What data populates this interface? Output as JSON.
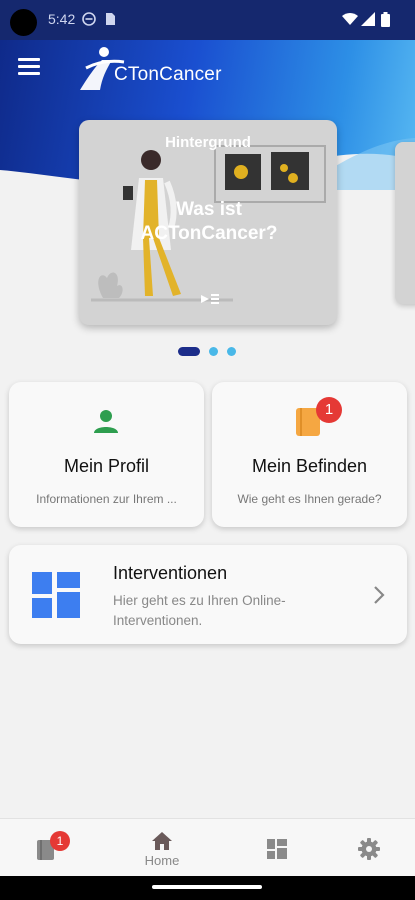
{
  "status_bar": {
    "time": "5:42"
  },
  "header": {
    "logo_text": "CTonCancer"
  },
  "carousel": {
    "label": "Hintergrund",
    "title": "Was ist ACTonCancer?",
    "page_count": 3,
    "active_index": 0
  },
  "cards": {
    "profile": {
      "title": "Mein Profil",
      "subtitle": "Informationen zur Ihrem ..."
    },
    "wellbeing": {
      "title": "Mein Befinden",
      "subtitle": "Wie geht es Ihnen gerade?",
      "badge": "1"
    },
    "interventions": {
      "title": "Interventionen",
      "subtitle": "Hier geht es zu Ihren Online-Interventionen."
    }
  },
  "bottom_nav": {
    "diary_badge": "1",
    "home_label": "Home"
  },
  "colors": {
    "brand_dark": "#15286e",
    "brand_light": "#58b9f2",
    "accent_blue": "#3d7ef0",
    "badge_red": "#e53935",
    "profile_green": "#2e9e4f",
    "book_orange": "#f5a742"
  }
}
